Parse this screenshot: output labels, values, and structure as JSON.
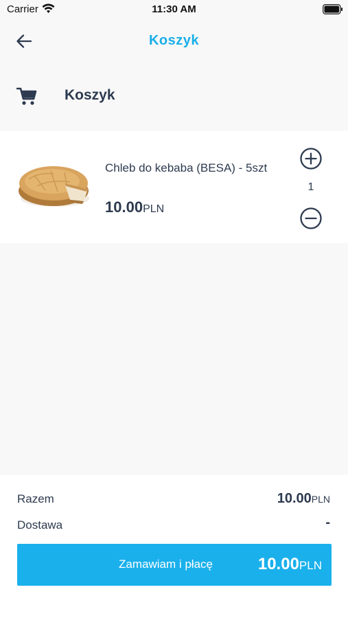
{
  "status_bar": {
    "carrier": "Carrier",
    "time": "11:30 AM",
    "wifi_icon": "wifi-icon",
    "battery_icon": "battery-icon"
  },
  "nav": {
    "title": "Koszyk",
    "back_icon": "arrow-left-icon",
    "accent_color": "#19aee8"
  },
  "section": {
    "title": "Koszyk",
    "icon": "cart-icon"
  },
  "cart": {
    "items": [
      {
        "name": "Chleb do kebaba (BESA) - 5szt",
        "price": "10.00",
        "currency": "PLN",
        "quantity": "1",
        "image_icon": "bread-image",
        "plus_icon": "plus-circle-icon",
        "minus_icon": "minus-circle-icon"
      }
    ]
  },
  "summary": {
    "total_label": "Razem",
    "total_amount": "10.00",
    "total_currency": "PLN",
    "delivery_label": "Dostawa",
    "delivery_value": "-"
  },
  "order_button": {
    "label": "Zamawiam i płacę",
    "amount": "10.00",
    "currency": "PLN",
    "color": "#1ab0ec"
  }
}
